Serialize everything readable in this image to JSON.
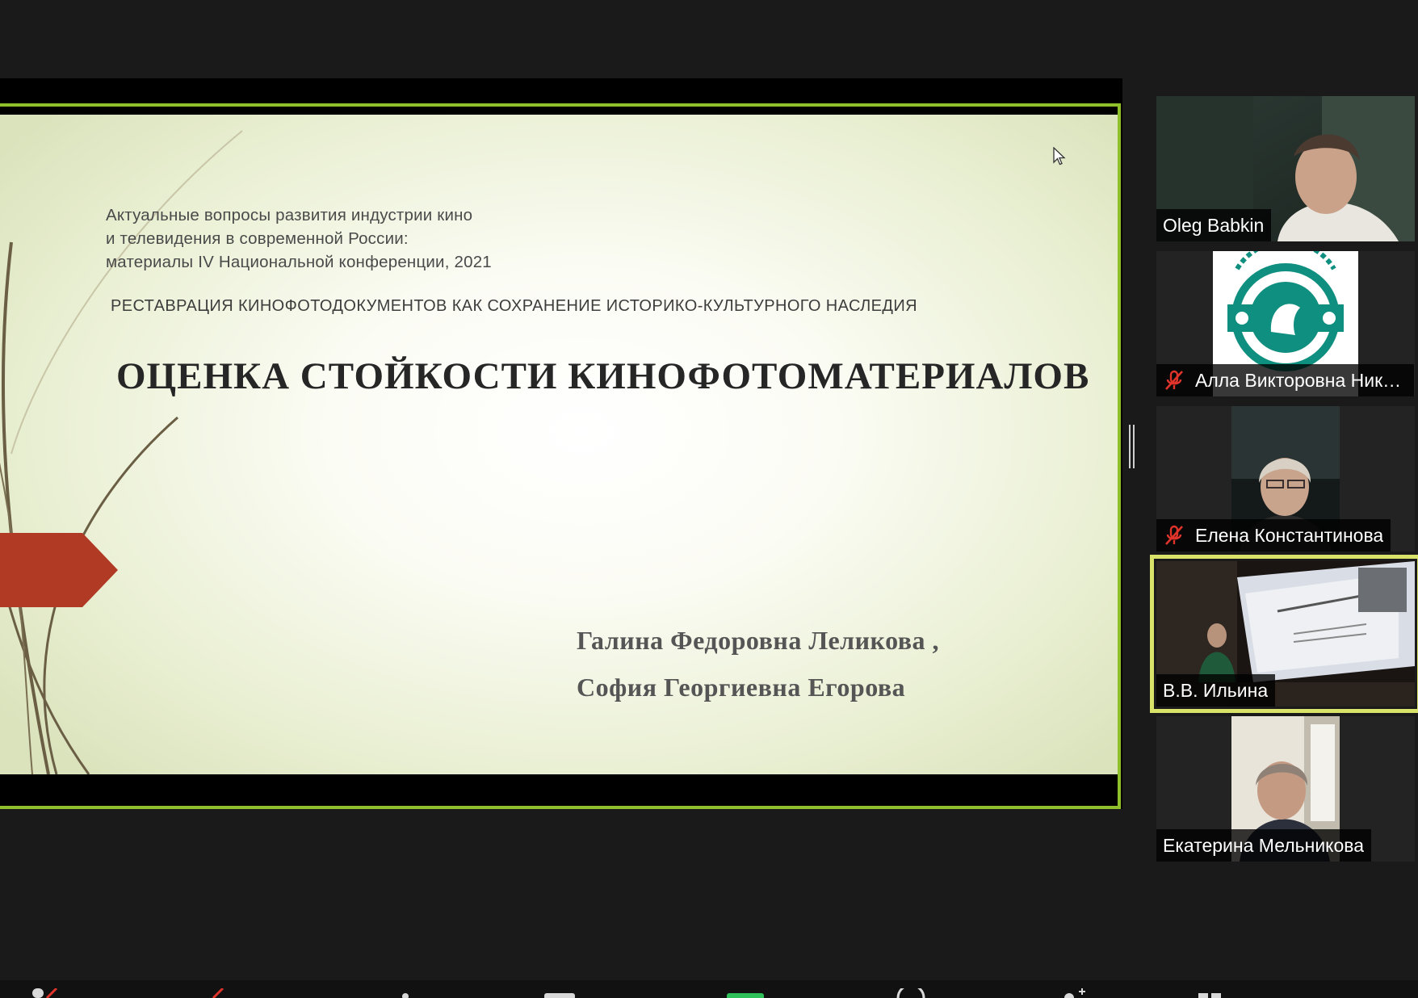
{
  "slide": {
    "meta_lines": [
      "Актуальные вопросы развития индустрии кино",
      "и телевидения в современной России:",
      "материалы IV Национальной конференции, 2021"
    ],
    "section": "РЕСТАВРАЦИЯ КИНОФОТОДОКУМЕНТОВ КАК СОХРАНЕНИЕ ИСТОРИКО-КУЛЬТУРНОГО НАСЛЕДИЯ",
    "title": "ОЦЕНКА СТОЙКОСТИ КИНОФОТОМАТЕРИАЛОВ",
    "authors": [
      "Галина Федоровна Леликова ,",
      "София Георгиевна Егорова"
    ],
    "colors": {
      "accent_arrow": "#b13a25",
      "share_border": "#8fbf2a"
    }
  },
  "participants": [
    {
      "name": "Oleg Babkin",
      "muted": false,
      "active": false,
      "video": "person-video"
    },
    {
      "name": "Алла Викторовна Никифорова",
      "muted": true,
      "active": false,
      "video": "university-logo"
    },
    {
      "name": "Елена Константинова",
      "muted": true,
      "active": false,
      "video": "person-video"
    },
    {
      "name": "В.В. Ильина",
      "muted": false,
      "active": true,
      "video": "lecture-hall-video"
    },
    {
      "name": "Екатерина Мельникова",
      "muted": false,
      "active": false,
      "video": "person-video"
    }
  ],
  "toolbar": {
    "icons": [
      "microphone-icon",
      "video-icon",
      "participants-icon",
      "chat-icon",
      "share-screen-icon",
      "record-icon",
      "reactions-icon",
      "apps-icon"
    ]
  }
}
